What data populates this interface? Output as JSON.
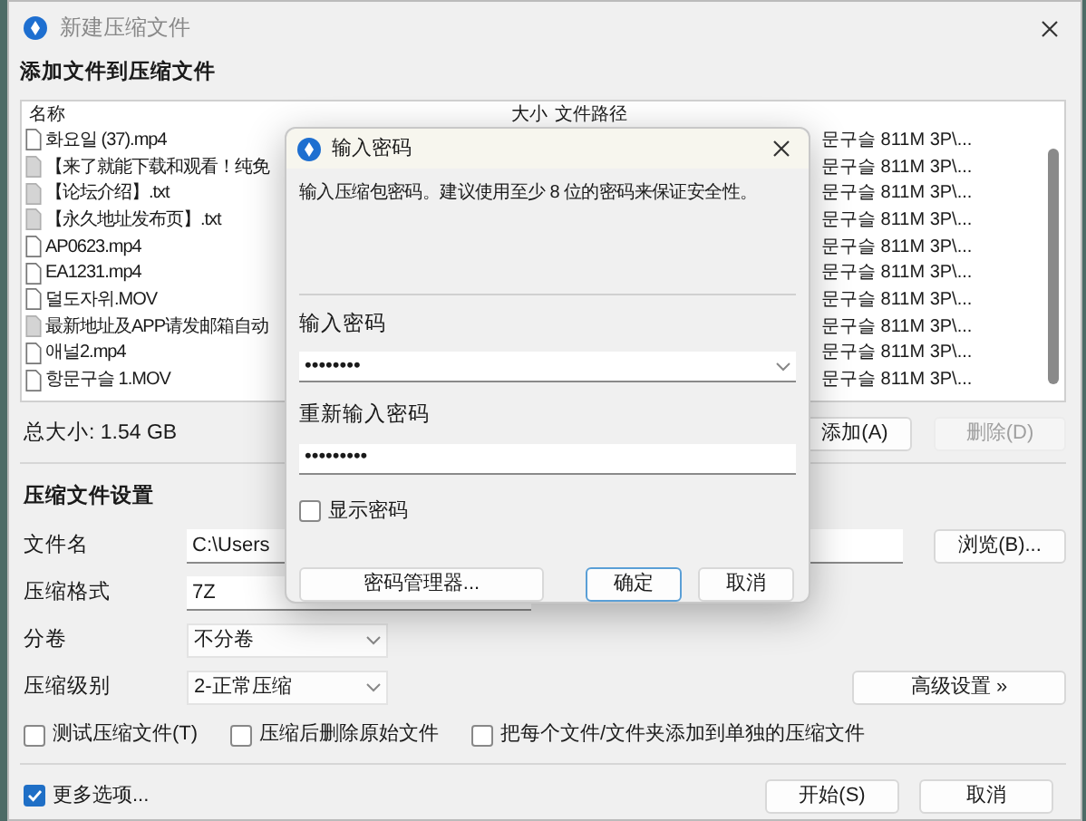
{
  "window": {
    "title": "新建压缩文件"
  },
  "files_section": {
    "heading": "添加文件到压缩文件",
    "columns": [
      "名称",
      "大小",
      "文件路径"
    ],
    "rows": [
      {
        "name": "화요일 (37).mp4",
        "kind": "video",
        "path": "문구슬 811M 3P\\..."
      },
      {
        "name": "【来了就能下载和观看！纯免",
        "kind": "text",
        "path": "문구슬 811M 3P\\..."
      },
      {
        "name": "【论坛介绍】.txt",
        "kind": "text",
        "path": "문구슬 811M 3P\\..."
      },
      {
        "name": "【永久地址发布页】.txt",
        "kind": "text",
        "path": "문구슬 811M 3P\\..."
      },
      {
        "name": "AP0623.mp4",
        "kind": "video",
        "path": "문구슬 811M 3P\\..."
      },
      {
        "name": "EA1231.mp4",
        "kind": "video",
        "path": "문구슬 811M 3P\\..."
      },
      {
        "name": "덜도자위.MOV",
        "kind": "video",
        "path": "문구슬 811M 3P\\..."
      },
      {
        "name": "最新地址及APP请发邮箱自动",
        "kind": "text",
        "path": "문구슬 811M 3P\\..."
      },
      {
        "name": "애널2.mp4",
        "kind": "video",
        "path": "문구슬 811M 3P\\..."
      },
      {
        "name": "항문구슬 1.MOV",
        "kind": "video",
        "path": "문구슬 811M 3P\\..."
      }
    ],
    "total": "总大小: 1.54 GB",
    "buttons": [
      {
        "label": "添加(A)",
        "disabled": false
      },
      {
        "label": "删除(D)",
        "disabled": true
      }
    ]
  },
  "settings": {
    "heading": "压缩文件设置",
    "fields": [
      {
        "label": "文件名",
        "kind": "text",
        "value": "C:\\Users"
      },
      {
        "label": "压缩格式",
        "kind": "text",
        "value": "7Z"
      },
      {
        "label": "分卷",
        "kind": "select",
        "value": "不分卷"
      },
      {
        "label": "压缩级别",
        "kind": "select",
        "value": "2-正常压缩"
      }
    ],
    "browse_button": "浏览(B)...",
    "advanced_button": "高级设置 »",
    "options": [
      {
        "label": "测试压缩文件(T)",
        "checked": false
      },
      {
        "label": "压缩后删除原始文件",
        "checked": false
      },
      {
        "label": "把每个文件/文件夹添加到单独的压缩文件",
        "checked": false
      }
    ]
  },
  "footer": {
    "more_options": {
      "label": "更多选项...",
      "checked": true
    },
    "buttons": [
      {
        "label": "开始(S)"
      },
      {
        "label": "取消"
      }
    ]
  },
  "dialog": {
    "title": "输入密码",
    "message": "输入压缩包密码。建议使用至少 8 位的密码来保证安全性。",
    "password_label": "输入密码",
    "password": "••••••••",
    "confirm_label": "重新输入密码",
    "confirm": "•••••••••",
    "show_password": {
      "label": "显示密码",
      "checked": false
    },
    "buttons": [
      {
        "label": "密码管理器...",
        "default": false
      },
      {
        "label": "确定",
        "default": true
      },
      {
        "label": "取消",
        "default": false
      }
    ]
  }
}
